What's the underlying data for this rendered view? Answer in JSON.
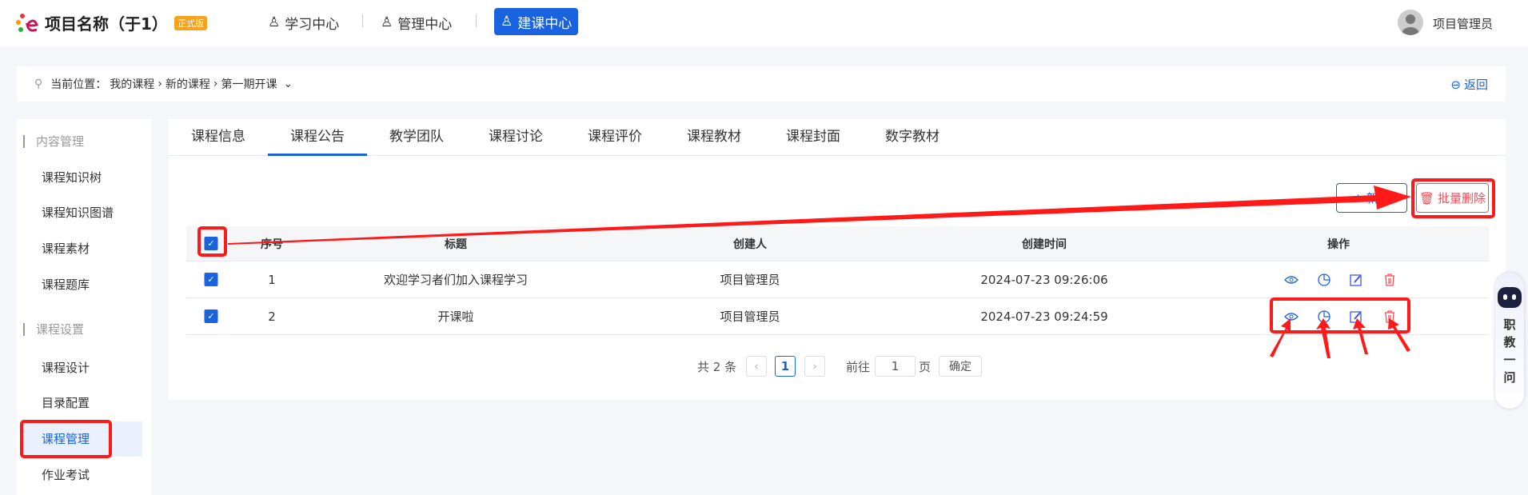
{
  "header": {
    "app_title": "项目名称（于1）",
    "edition_badge": "正式版",
    "nav": [
      {
        "label": "学习中心",
        "icon": "graduate-icon"
      },
      {
        "label": "管理中心",
        "icon": "user-gear-icon"
      },
      {
        "label": "建课中心",
        "icon": "user-edit-icon",
        "active": true
      }
    ],
    "user_name": "项目管理员"
  },
  "breadcrumb": {
    "prefix": "当前位置：",
    "items": [
      "我的课程",
      "新的课程",
      "第一期开课"
    ],
    "back_label": "返回"
  },
  "sidebar": {
    "groups": [
      {
        "label": "内容管理",
        "items": [
          "课程知识树",
          "课程知识图谱",
          "课程素材",
          "课程题库"
        ]
      },
      {
        "label": "课程设置",
        "items": [
          "课程设计",
          "目录配置",
          "课程管理",
          "作业考试"
        ]
      }
    ],
    "selected": "课程管理"
  },
  "tabs": [
    "课程信息",
    "课程公告",
    "教学团队",
    "课程讨论",
    "课程评价",
    "课程教材",
    "课程封面",
    "数字教材"
  ],
  "active_tab": "课程公告",
  "toolbar": {
    "add_label": "新增",
    "batch_delete_label": "批量删除"
  },
  "table": {
    "columns": [
      "序号",
      "标题",
      "创建人",
      "创建时间",
      "操作"
    ],
    "rows": [
      {
        "index": "1",
        "title": "欢迎学习者们加入课程学习",
        "creator": "项目管理员",
        "created": "2024-07-23 09:26:06",
        "checked": true
      },
      {
        "index": "2",
        "title": "开课啦",
        "creator": "项目管理员",
        "created": "2024-07-23 09:24:59",
        "checked": true
      }
    ],
    "actions": [
      "eye-icon",
      "pie-chart-icon",
      "edit-icon",
      "trash-icon"
    ]
  },
  "pagination": {
    "total": "共 2 条",
    "current": "1",
    "goto_label": "前往",
    "goto_value": "1",
    "page_unit": "页",
    "confirm": "确定"
  },
  "assistant": {
    "label": [
      "职",
      "教",
      "一",
      "问"
    ]
  },
  "colors": {
    "primary": "#1a63e0",
    "danger": "#f0505a",
    "annotation": "#ff1a1a"
  }
}
